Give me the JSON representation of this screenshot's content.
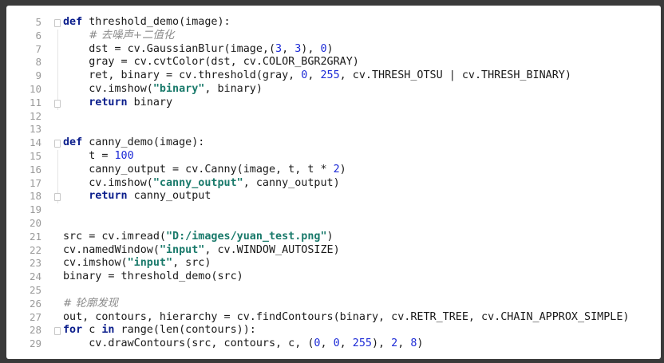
{
  "editor": {
    "lines": [
      {
        "num": "5",
        "tokens": [
          [
            "kw",
            "def"
          ],
          [
            "p",
            " threshold_demo(image):"
          ]
        ]
      },
      {
        "num": "6",
        "tokens": [
          [
            "p",
            "    "
          ],
          [
            "c",
            "# 去噪声+二值化"
          ]
        ]
      },
      {
        "num": "7",
        "tokens": [
          [
            "p",
            "    dst = cv.GaussianBlur(image,("
          ],
          [
            "n",
            "3"
          ],
          [
            "p",
            ", "
          ],
          [
            "n",
            "3"
          ],
          [
            "p",
            "), "
          ],
          [
            "n",
            "0"
          ],
          [
            "p",
            ")"
          ]
        ]
      },
      {
        "num": "8",
        "tokens": [
          [
            "p",
            "    gray = cv.cvtColor(dst, cv.COLOR_BGR2GRAY)"
          ]
        ]
      },
      {
        "num": "9",
        "tokens": [
          [
            "p",
            "    ret, binary = cv.threshold(gray, "
          ],
          [
            "n",
            "0"
          ],
          [
            "p",
            ", "
          ],
          [
            "n",
            "255"
          ],
          [
            "p",
            ", cv.THRESH_OTSU | cv.THRESH_BINARY)"
          ]
        ]
      },
      {
        "num": "10",
        "tokens": [
          [
            "p",
            "    cv.imshow("
          ],
          [
            "s",
            "\"binary\""
          ],
          [
            "p",
            ", binary)"
          ]
        ]
      },
      {
        "num": "11",
        "tokens": [
          [
            "p",
            "    "
          ],
          [
            "kw",
            "return"
          ],
          [
            "p",
            " binary"
          ]
        ]
      },
      {
        "num": "12",
        "tokens": []
      },
      {
        "num": "13",
        "tokens": []
      },
      {
        "num": "14",
        "tokens": [
          [
            "kw",
            "def"
          ],
          [
            "p",
            " canny_demo(image):"
          ]
        ]
      },
      {
        "num": "15",
        "tokens": [
          [
            "p",
            "    t = "
          ],
          [
            "n",
            "100"
          ]
        ]
      },
      {
        "num": "16",
        "tokens": [
          [
            "p",
            "    canny_output = cv.Canny(image, t, t * "
          ],
          [
            "n",
            "2"
          ],
          [
            "p",
            ")"
          ]
        ]
      },
      {
        "num": "17",
        "tokens": [
          [
            "p",
            "    cv.imshow("
          ],
          [
            "s",
            "\"canny_output\""
          ],
          [
            "p",
            ", canny_output)"
          ]
        ]
      },
      {
        "num": "18",
        "tokens": [
          [
            "p",
            "    "
          ],
          [
            "kw",
            "return"
          ],
          [
            "p",
            " canny_output"
          ]
        ]
      },
      {
        "num": "19",
        "tokens": []
      },
      {
        "num": "20",
        "tokens": []
      },
      {
        "num": "21",
        "tokens": [
          [
            "p",
            "src = cv.imread("
          ],
          [
            "s",
            "\"D:/images/yuan_test.png\""
          ],
          [
            "p",
            ")"
          ]
        ]
      },
      {
        "num": "22",
        "tokens": [
          [
            "p",
            "cv.namedWindow("
          ],
          [
            "s",
            "\"input\""
          ],
          [
            "p",
            ", cv.WINDOW_AUTOSIZE)"
          ]
        ]
      },
      {
        "num": "23",
        "tokens": [
          [
            "p",
            "cv.imshow("
          ],
          [
            "s",
            "\"input\""
          ],
          [
            "p",
            ", src)"
          ]
        ]
      },
      {
        "num": "24",
        "tokens": [
          [
            "p",
            "binary = threshold_demo(src)"
          ]
        ]
      },
      {
        "num": "25",
        "tokens": []
      },
      {
        "num": "26",
        "tokens": [
          [
            "c",
            "# 轮廓发现"
          ]
        ]
      },
      {
        "num": "27",
        "tokens": [
          [
            "p",
            "out, contours, hierarchy = cv.findContours(binary, cv.RETR_TREE, cv.CHAIN_APPROX_SIMPLE)"
          ]
        ]
      },
      {
        "num": "28",
        "tokens": [
          [
            "kw",
            "for"
          ],
          [
            "p",
            " c "
          ],
          [
            "kw",
            "in"
          ],
          [
            "p",
            " range(len(contours)):"
          ]
        ]
      },
      {
        "num": "29",
        "tokens": [
          [
            "p",
            "    cv.drawContours(src, contours, c, ("
          ],
          [
            "n",
            "0"
          ],
          [
            "p",
            ", "
          ],
          [
            "n",
            "0"
          ],
          [
            "p",
            ", "
          ],
          [
            "n",
            "255"
          ],
          [
            "p",
            "), "
          ],
          [
            "n",
            "2"
          ],
          [
            "p",
            ", "
          ],
          [
            "n",
            "8"
          ],
          [
            "p",
            ")"
          ]
        ]
      }
    ],
    "fold_markers": [
      "5",
      "11",
      "14",
      "18",
      "28"
    ]
  }
}
